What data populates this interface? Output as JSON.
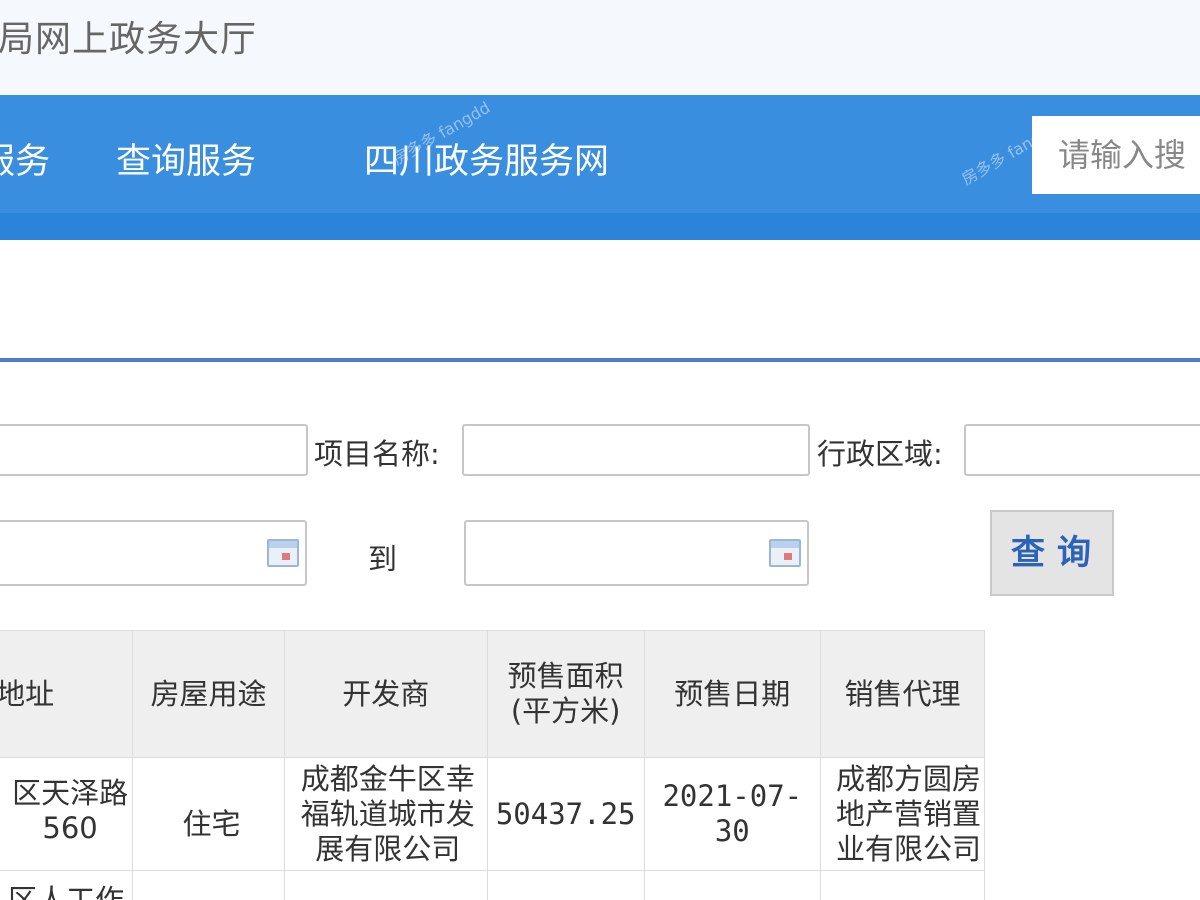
{
  "header": {
    "title": "局网上政务大厅"
  },
  "nav": {
    "items": [
      "服务",
      "查询服务",
      "四川政务服务网"
    ],
    "search_placeholder": "请输入搜"
  },
  "watermark": {
    "text": "房多多 fangdd"
  },
  "form": {
    "project_name_label": "项目名称:",
    "district_label": "行政区域:",
    "to_label": "到",
    "query_button": "查询"
  },
  "table": {
    "headers": [
      "项目地址",
      "房屋用途",
      "开发商",
      "预售面积(平方米)",
      "预售日期",
      "销售代理"
    ],
    "header_area_line1": "预售面积",
    "header_area_line2": "(平方米)",
    "header_address": "目地址",
    "rows": [
      {
        "address": "区天泽路560",
        "usage": "住宅",
        "developer": "成都金牛区幸福轨道城市发展有限公司",
        "area": "50437.25",
        "date": "2021-07-30",
        "agent": "成都方圆房地产营销置业有限公司"
      },
      {
        "address": "区人工作",
        "usage": "",
        "developer": "",
        "area": "",
        "date": "",
        "agent": ""
      }
    ]
  }
}
